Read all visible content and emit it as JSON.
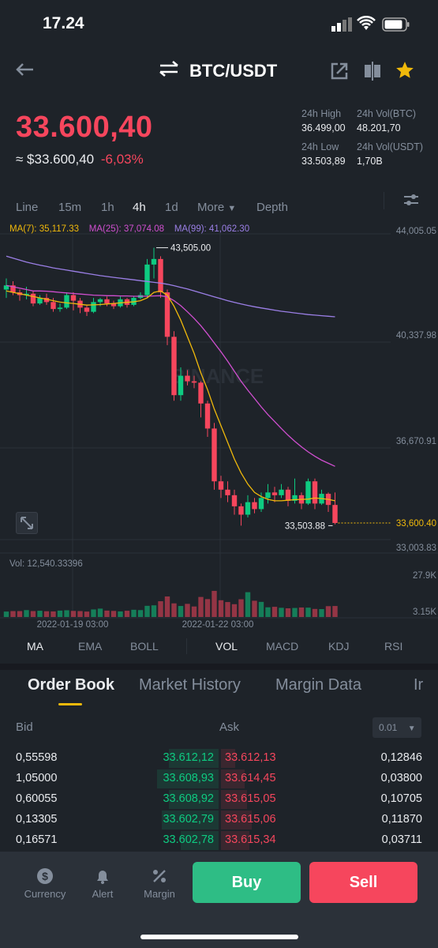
{
  "status": {
    "time": "17.24"
  },
  "header": {
    "pair": "BTC/USDT"
  },
  "ticker": {
    "last_price": "33.600,40",
    "usd_price": "≈ $33.600,40",
    "change": "-6,03%",
    "high_label": "24h High",
    "high_value": "36.499,00",
    "vol_btc_label": "24h Vol(BTC)",
    "vol_btc_value": "48.201,70",
    "low_label": "24h Low",
    "low_value": "33.503,89",
    "vol_usdt_label": "24h Vol(USDT)",
    "vol_usdt_value": "1,70B"
  },
  "timeframes": {
    "line": "Line",
    "m15": "15m",
    "h1": "1h",
    "h4": "4h",
    "d1": "1d",
    "more": "More",
    "depth": "Depth",
    "active": "4h"
  },
  "chart_data": {
    "type": "candlestick",
    "ma_labels": {
      "ma7": "MA(7): 35,117.33",
      "ma25": "MA(25): 37,074.08",
      "ma99": "MA(99): 41,062.30"
    },
    "price_axis": [
      "44,005.05",
      "40,337.98",
      "36,670.91",
      "33,003.83"
    ],
    "x_ticks": [
      "2022-01-19 03:00",
      "2022-01-22 03:00"
    ],
    "high_marker": "43,505.00",
    "low_marker": "33,503.88",
    "current_price_tag": "33,600.40",
    "vol_label": "Vol: 12,540.33396",
    "vol_axis": [
      "27.9K",
      "3.15K"
    ],
    "watermark": "BINANCE",
    "ylim": [
      33003.83,
      44005.05
    ],
    "candles": [
      [
        42000,
        42150,
        41700,
        42400
      ],
      [
        42150,
        41900,
        41800,
        42300
      ],
      [
        41900,
        41800,
        41600,
        42000
      ],
      [
        41800,
        41850,
        41650,
        42100
      ],
      [
        41850,
        41500,
        41400,
        41950
      ],
      [
        41500,
        41700,
        41450,
        41800
      ],
      [
        41700,
        41550,
        41450,
        41850
      ],
      [
        41550,
        41300,
        41200,
        41700
      ],
      [
        41300,
        41350,
        41200,
        41500
      ],
      [
        41350,
        41800,
        41300,
        41900
      ],
      [
        41800,
        41600,
        41250,
        41900
      ],
      [
        41600,
        41350,
        41150,
        41700
      ],
      [
        41350,
        41200,
        41050,
        41450
      ],
      [
        41200,
        41550,
        41150,
        41700
      ],
      [
        41550,
        41650,
        41400,
        41700
      ],
      [
        41650,
        41500,
        41400,
        41750
      ],
      [
        41500,
        41400,
        41300,
        41600
      ],
      [
        41400,
        41650,
        41350,
        41750
      ],
      [
        41650,
        41450,
        41350,
        41700
      ],
      [
        41450,
        41700,
        41400,
        41750
      ],
      [
        41700,
        41800,
        41650,
        41900
      ],
      [
        41800,
        42900,
        41700,
        43100
      ],
      [
        42900,
        43100,
        42400,
        43505
      ],
      [
        43100,
        41900,
        41700,
        43200
      ],
      [
        41900,
        40300,
        40000,
        42000
      ],
      [
        40300,
        38200,
        38000,
        40500
      ],
      [
        38200,
        38900,
        38000,
        39200
      ],
      [
        38900,
        38700,
        38550,
        39100
      ],
      [
        38700,
        38650,
        38450,
        38900
      ],
      [
        38650,
        37900,
        37400,
        38700
      ],
      [
        37900,
        37000,
        36700,
        38000
      ],
      [
        37000,
        35100,
        34800,
        37200
      ],
      [
        35100,
        34800,
        34500,
        35300
      ],
      [
        34800,
        34600,
        34350,
        35100
      ],
      [
        34600,
        34200,
        33900,
        34800
      ],
      [
        34200,
        33900,
        33503.88,
        34300
      ],
      [
        33900,
        34350,
        33800,
        34600
      ],
      [
        34350,
        34100,
        33950,
        34500
      ],
      [
        34100,
        34500,
        34000,
        34700
      ],
      [
        34500,
        34700,
        34300,
        35000
      ],
      [
        34700,
        34600,
        34350,
        34900
      ],
      [
        34600,
        34800,
        34500,
        35000
      ],
      [
        34800,
        34400,
        34200,
        34900
      ],
      [
        34400,
        34600,
        34300,
        35200
      ],
      [
        34600,
        34300,
        34100,
        34700
      ],
      [
        34300,
        35100,
        34250,
        35200
      ],
      [
        35100,
        34300,
        34100,
        35200
      ],
      [
        34300,
        34650,
        34250,
        34800
      ],
      [
        34650,
        34250,
        34000,
        34700
      ],
      [
        34250,
        33600.4,
        33550,
        34700
      ]
    ],
    "volumes": [
      3.3,
      3.6,
      3.6,
      4.2,
      3.6,
      3.8,
      3.5,
      3.4,
      3.9,
      4.1,
      3.7,
      3.6,
      3.3,
      4.6,
      5.1,
      3.9,
      3.7,
      3.4,
      3.8,
      4.4,
      4.2,
      6.8,
      7.1,
      9.6,
      12.5,
      8.3,
      6.7,
      8.0,
      6.4,
      12.2,
      10.9,
      15.9,
      10.2,
      9.1,
      7.8,
      10.8,
      15.1,
      9.9,
      9.2,
      5.9,
      6.2,
      5.6,
      5.3,
      5.5,
      5.8,
      5.7,
      4.9,
      4.8,
      6.6,
      6.7
    ],
    "ma7": [
      41950,
      41900,
      41850,
      41800,
      41750,
      41700,
      41650,
      41600,
      41550,
      41520,
      41500,
      41470,
      41440,
      41450,
      41460,
      41480,
      41500,
      41520,
      41540,
      41560,
      41600,
      41700,
      41900,
      41950,
      41800,
      41400,
      40900,
      40300,
      39700,
      39000,
      38400,
      37700,
      37100,
      36500,
      35900,
      35400,
      35000,
      34700,
      34550,
      34450,
      34400,
      34400,
      34420,
      34440,
      34450,
      34460,
      34500,
      34480,
      34450,
      34400
    ],
    "ma25": [
      42150,
      42100,
      42050,
      42000,
      41950,
      41950,
      41940,
      41920,
      41900,
      41880,
      41860,
      41840,
      41820,
      41800,
      41790,
      41780,
      41780,
      41770,
      41770,
      41760,
      41760,
      41760,
      41770,
      41780,
      41740,
      41600,
      41420,
      41200,
      40960,
      40700,
      40400,
      40080,
      39760,
      39420,
      39060,
      38700,
      38380,
      38080,
      37780,
      37500,
      37250,
      37000,
      36760,
      36540,
      36340,
      36160,
      36000,
      35860,
      35750,
      35640
    ],
    "ma99": [
      43200,
      43130,
      43060,
      42990,
      42930,
      42880,
      42830,
      42780,
      42740,
      42700,
      42660,
      42620,
      42580,
      42540,
      42500,
      42470,
      42440,
      42410,
      42380,
      42350,
      42320,
      42290,
      42260,
      42230,
      42190,
      42140,
      42080,
      42020,
      41950,
      41880,
      41810,
      41740,
      41670,
      41600,
      41540,
      41480,
      41430,
      41380,
      41340,
      41300,
      41260,
      41220,
      41190,
      41160,
      41130,
      41100,
      41080,
      41060,
      41040,
      41020
    ]
  },
  "indicators": {
    "ma": "MA",
    "ema": "EMA",
    "boll": "BOLL",
    "vol": "VOL",
    "macd": "MACD",
    "kdj": "KDJ",
    "rsi": "RSI"
  },
  "orderbook": {
    "tabs": [
      "Order Book",
      "Market History",
      "Margin Data",
      "Ir"
    ],
    "bid_label": "Bid",
    "ask_label": "Ask",
    "precision": "0.01",
    "rows": [
      {
        "bid_qty": "0,55598",
        "bid_price": "33.612,12",
        "ask_price": "33.612,13",
        "ask_qty": "0,12846"
      },
      {
        "bid_qty": "1,05000",
        "bid_price": "33.608,93",
        "ask_price": "33.614,45",
        "ask_qty": "0,03800"
      },
      {
        "bid_qty": "0,60055",
        "bid_price": "33.608,92",
        "ask_price": "33.615,05",
        "ask_qty": "0,10705"
      },
      {
        "bid_qty": "0,13305",
        "bid_price": "33.602,79",
        "ask_price": "33.615,06",
        "ask_qty": "0,11870"
      },
      {
        "bid_qty": "0,16571",
        "bid_price": "33.602,78",
        "ask_price": "33.615,34",
        "ask_qty": "0,03711"
      }
    ]
  },
  "bottom_nav": {
    "currency": "Currency",
    "alert": "Alert",
    "margin": "Margin",
    "buy": "Buy",
    "sell": "Sell"
  },
  "colors": {
    "up": "#0ecb81",
    "down": "#f6465d",
    "accent": "#f0b90b",
    "ma7": "#f0b90b",
    "ma25": "#d04fd0",
    "ma99": "#9b7fe6",
    "buy_btn": "#2ebd85",
    "sell_btn": "#f6465d"
  }
}
